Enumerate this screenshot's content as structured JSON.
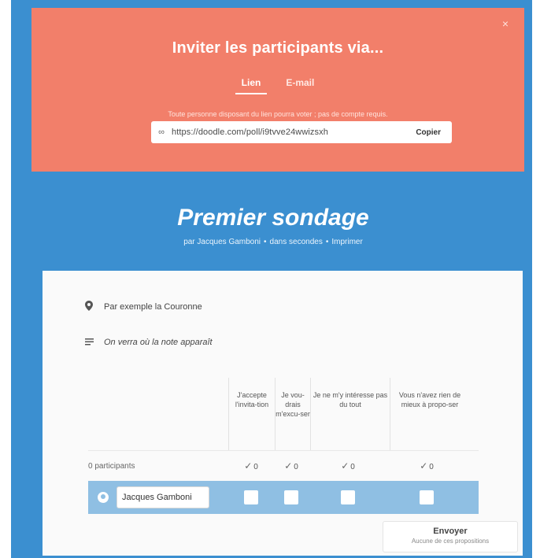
{
  "invite": {
    "title": "Inviter les participants via...",
    "close_icon": "×",
    "tabs": [
      {
        "label": "Lien"
      },
      {
        "label": "E-mail"
      }
    ],
    "helper_text": "Toute personne disposant du lien pourra voter ; pas de compte requis.",
    "link_icon": "∞",
    "url": "https://doodle.com/poll/i9tvve24wwizsxh",
    "copy_label": "Copier"
  },
  "poll": {
    "title": "Premier sondage",
    "author": "par Jacques Gamboni",
    "time": "dans secondes",
    "print_label": "Imprimer",
    "separator": "•"
  },
  "details": {
    "location": "Par exemple la Couronne",
    "note": "On verra où la note apparaît"
  },
  "table": {
    "options": [
      "J'accepte l'invita-tion",
      "Je vou-drais m'excu-ser",
      "Je ne m'y intéresse pas du tout",
      "Vous n'avez rien de mieux à propo-ser"
    ],
    "participants_label": "0 participants",
    "counts": [
      "0",
      "0",
      "0",
      "0"
    ],
    "check_glyph": "✓",
    "name_value": "Jacques Gamboni"
  },
  "send": {
    "label": "Envoyer",
    "sub": "Aucune de ces propositions"
  },
  "colors": {
    "background": "#3b8fd0",
    "invite_panel": "#f27f6a",
    "entry_row": "#8fbfe3"
  }
}
